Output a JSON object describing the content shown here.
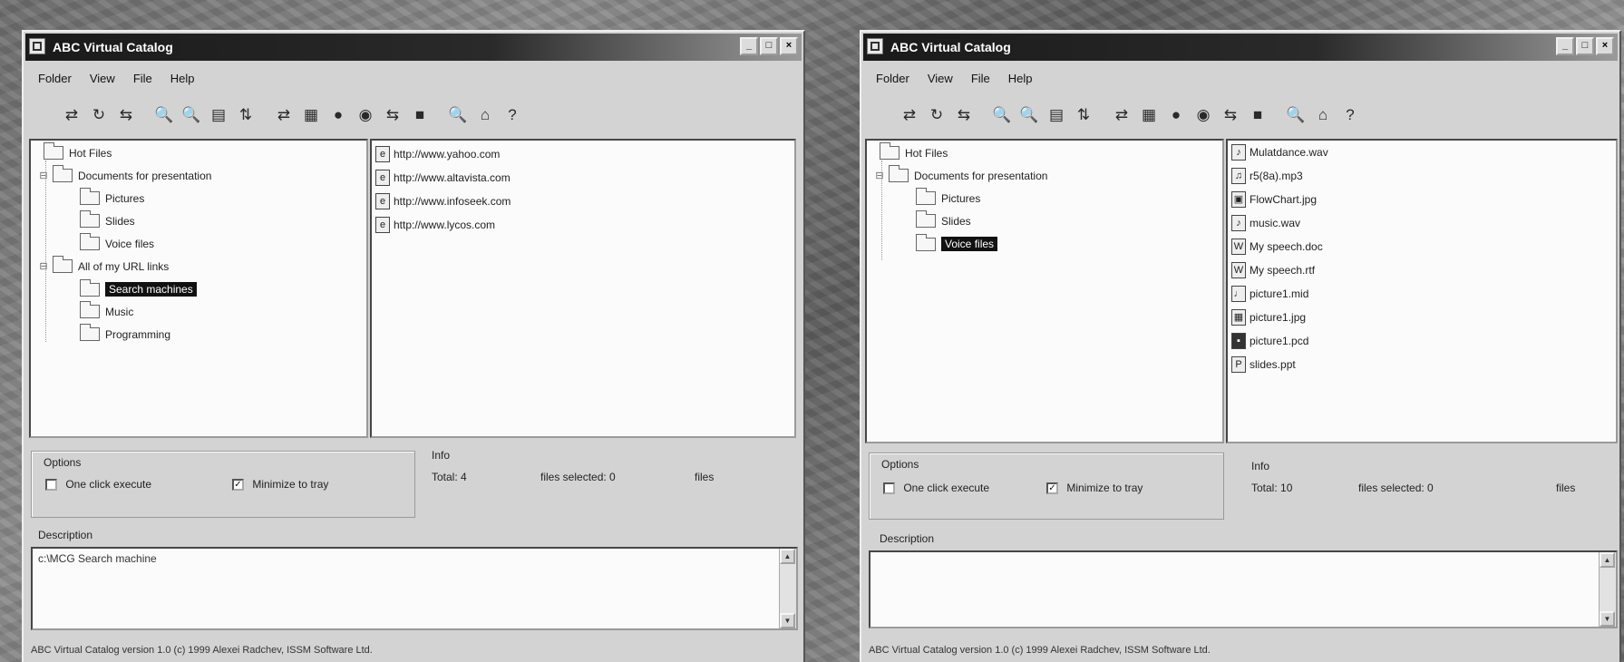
{
  "window_title": "ABC Virtual Catalog",
  "title_buttons": [
    "_",
    "□",
    "×"
  ],
  "menu": [
    "Folder",
    "View",
    "File",
    "Help"
  ],
  "toolbar_icons": [
    "⇄",
    "↻",
    "⇆",
    "🔍",
    "🔍",
    "▤",
    "⇅",
    "⇄",
    "▦",
    "●",
    "◉",
    "⇆",
    "■",
    "🔍",
    "⌂",
    "?"
  ],
  "toolbar_icon_names": [
    "move-icon",
    "refresh-icon",
    "swap-icon",
    "zoom-in-icon",
    "zoom-out-icon",
    "copy-icon",
    "sort-icon",
    "transfer-icon",
    "list-icon",
    "record-icon",
    "scan-icon",
    "swap2-icon",
    "monitor-icon",
    "find-icon",
    "home-icon",
    "help-icon"
  ],
  "options_label": "Options",
  "info_label": "Info",
  "description_label": "Description",
  "left": {
    "tree": {
      "hot_files": "Hot Files",
      "documents": "Documents for presentation",
      "pictures": "Pictures",
      "slides": "Slides",
      "voice": "Voice files",
      "urls": "All of my URL links",
      "search": "Search machines",
      "music": "Music",
      "programming": "Programming"
    },
    "files": [
      "http://www.yahoo.com",
      "http://www.altavista.com",
      "http://www.infoseek.com",
      "http://www.lycos.com"
    ],
    "options": {
      "one_click": "One click execute",
      "minimize": "Minimize to tray"
    },
    "info": {
      "total": "Total: 4",
      "selected": "files selected: 0",
      "files": "files"
    },
    "description": "c:\\MCG Search machine",
    "status": "ABC Virtual Catalog version 1.0 (c) 1999 Alexei Radchev, ISSM Software Ltd."
  },
  "right": {
    "tree": {
      "hot_files": "Hot Files",
      "documents": "Documents for presentation",
      "pictures": "Pictures",
      "slides": "Slides",
      "voice": "Voice files"
    },
    "files": [
      "Mulatdance.wav",
      "r5(8a).mp3",
      "FlowChart.jpg",
      "music.wav",
      "My speech.doc",
      "My speech.rtf",
      "picture1.mid",
      "picture1.jpg",
      "picture1.pcd",
      "slides.ppt"
    ],
    "options": {
      "one_click": "One click execute",
      "minimize": "Minimize to tray"
    },
    "info": {
      "total": "Total: 10",
      "selected": "files selected: 0",
      "files": "files"
    },
    "description": "",
    "status": "ABC Virtual Catalog version 1.0 (c) 1999 Alexei Radchev, ISSM Software Ltd."
  }
}
